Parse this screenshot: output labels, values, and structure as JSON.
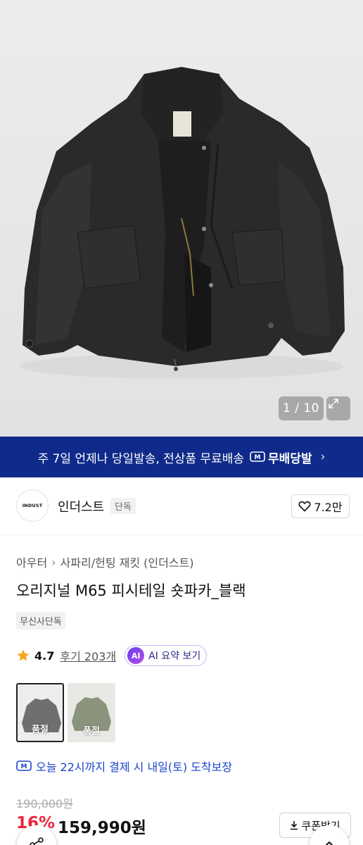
{
  "gallery": {
    "counter": "1 / 10",
    "image_subject": "black jacket"
  },
  "banner": {
    "text": "주 7일 언제나 당일발송, 전상품 무료배송",
    "badge": "무배당발",
    "color": "#0f2a8a"
  },
  "brand": {
    "logo_text": "INDUST",
    "name": "인더스트",
    "tag": "단독",
    "likes": "7.2만"
  },
  "product": {
    "breadcrumb": [
      "아우터",
      "사파리/헌팅 재킷 (인더스트)"
    ],
    "title": "오리지널 M65 피시테일 숏파카_블랙",
    "exclusive_tag": "무신사단독",
    "rating": "4.7",
    "reviews": "후기 203개",
    "ai_summary": "AI 요약 보기",
    "ai_badge": "AI",
    "options": [
      {
        "name": "black",
        "status": "품절"
      },
      {
        "name": "olive",
        "status": "품절"
      }
    ],
    "delivery": "오늘 22시까지 결제 시 내일(토) 도착보장",
    "original_price": "190,000원",
    "discount": "16%",
    "price": "159,990원",
    "coupon_button": "쿠폰받기"
  },
  "colors": {
    "accent_blue": "#1b46c8",
    "discount_red": "#f0253a",
    "star": "#f5a623"
  }
}
